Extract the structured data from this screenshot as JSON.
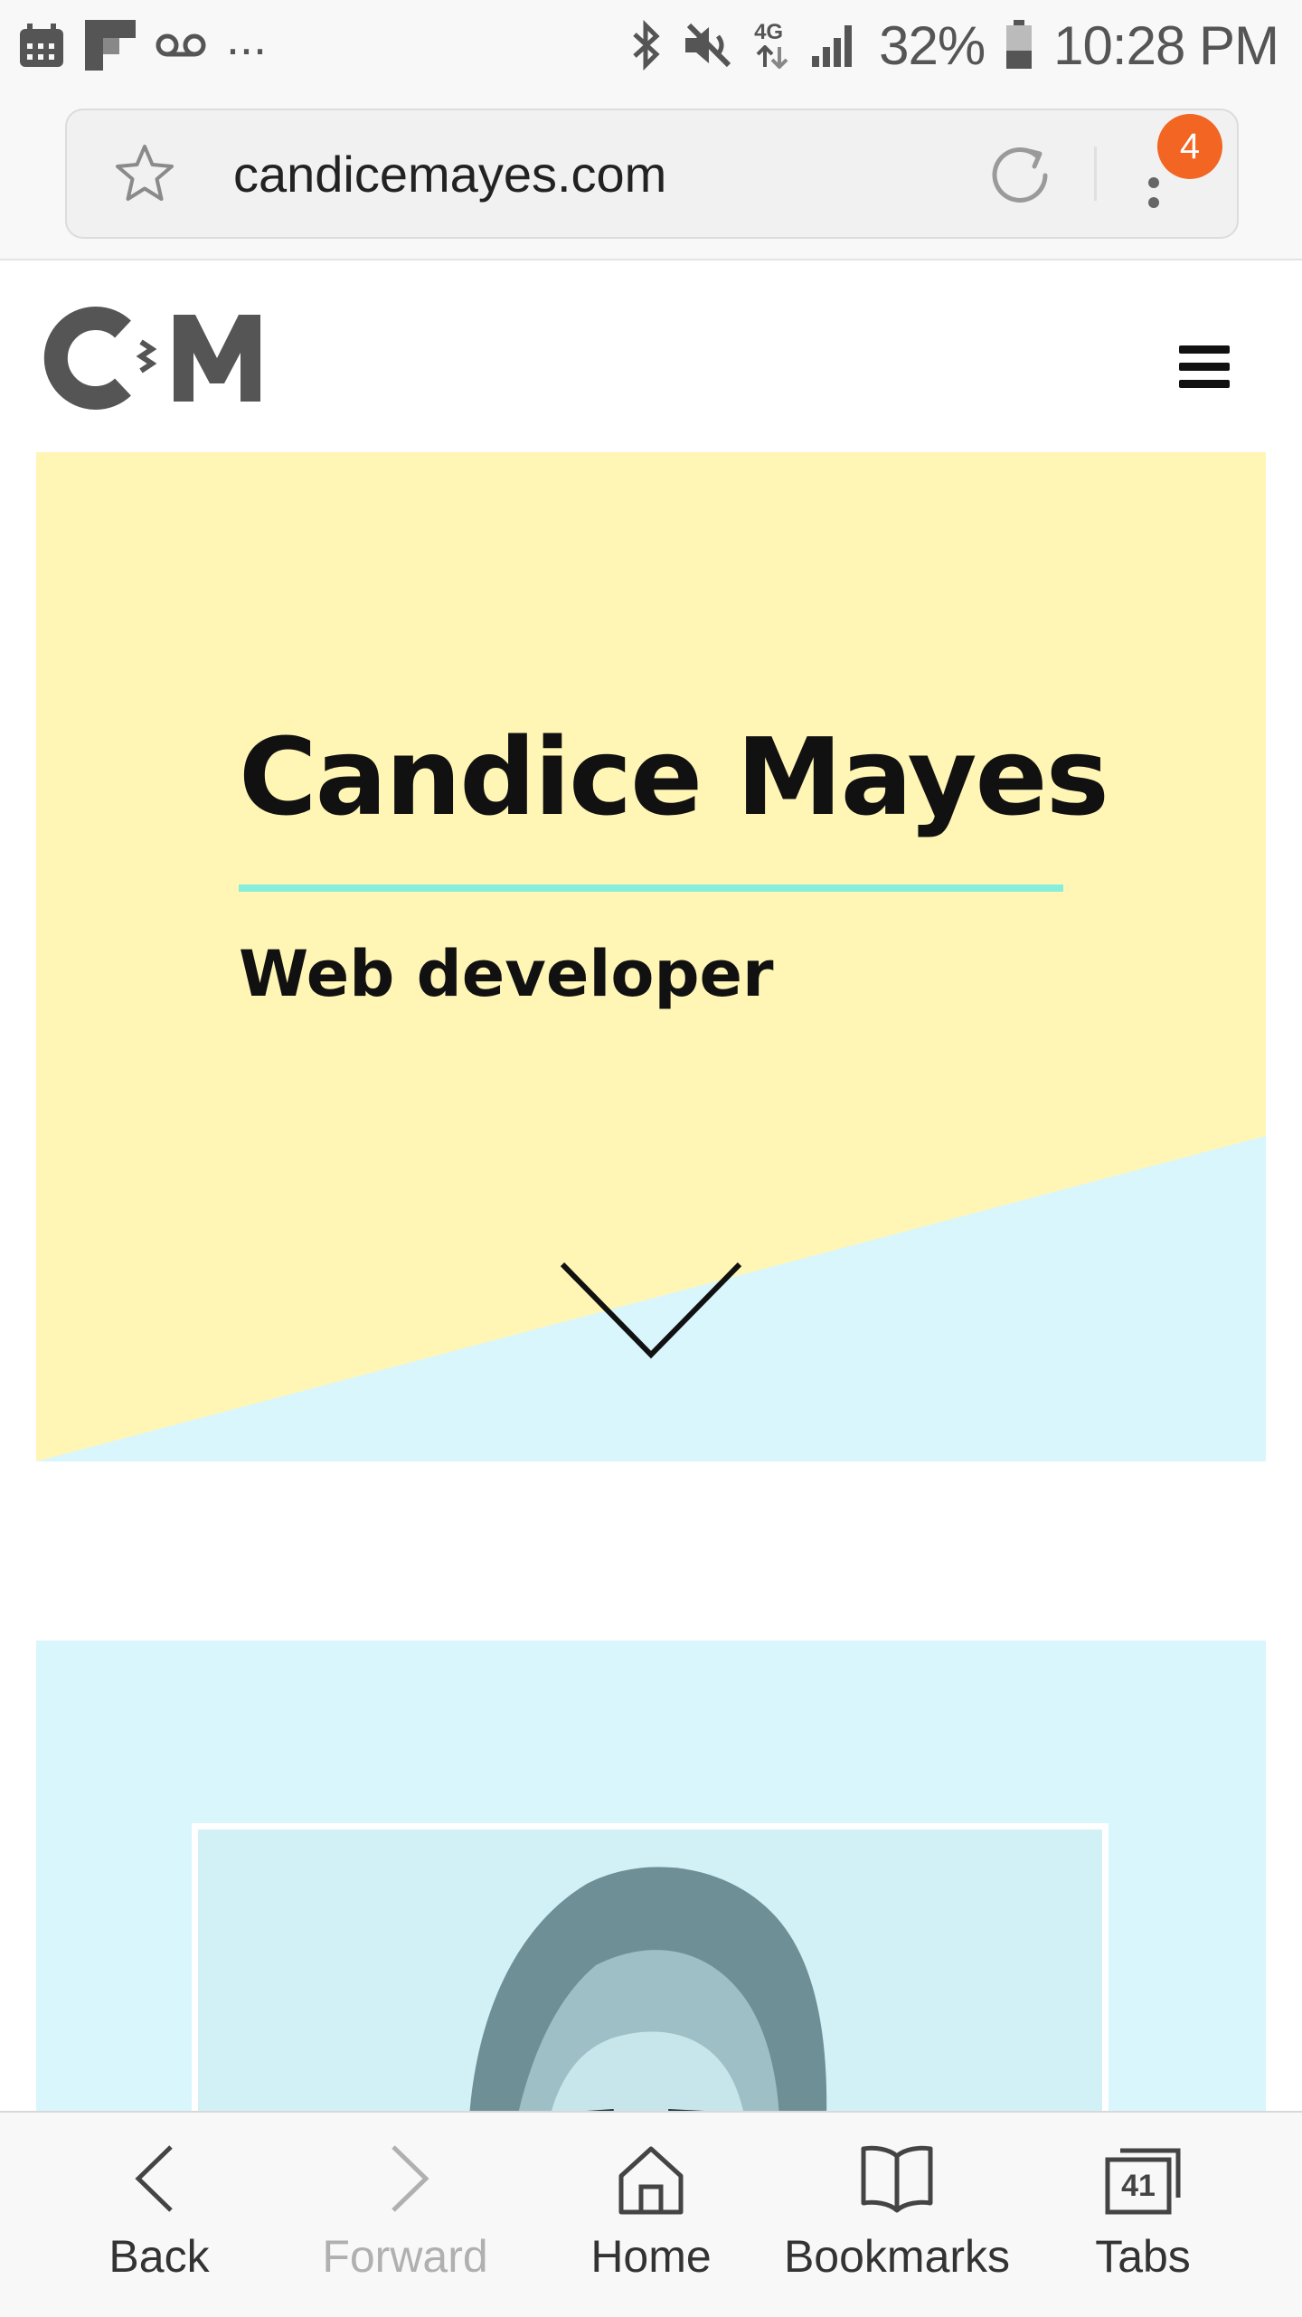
{
  "status_bar": {
    "overflow_dots": "...",
    "network": "4G",
    "battery_percent": "32%",
    "time": "10:28 PM"
  },
  "browser": {
    "url": "candicemayes.com",
    "menu_badge": "4"
  },
  "site": {
    "logo_alt": "C M"
  },
  "hero": {
    "title": "Candice Mayes",
    "subtitle": "Web developer"
  },
  "bottom_nav": {
    "items": [
      {
        "label": "Back",
        "icon": "chevron-left-icon",
        "enabled": true
      },
      {
        "label": "Forward",
        "icon": "chevron-right-icon",
        "enabled": false
      },
      {
        "label": "Home",
        "icon": "home-icon",
        "enabled": true
      },
      {
        "label": "Bookmarks",
        "icon": "book-icon",
        "enabled": true
      },
      {
        "label": "Tabs",
        "icon": "tabs-icon",
        "enabled": true
      }
    ],
    "tab_count": "41"
  },
  "colors": {
    "hero_yellow": "#fff6b6",
    "hero_blue": "#d9f6fc",
    "accent_rule": "#86eedb",
    "badge": "#f26522"
  }
}
